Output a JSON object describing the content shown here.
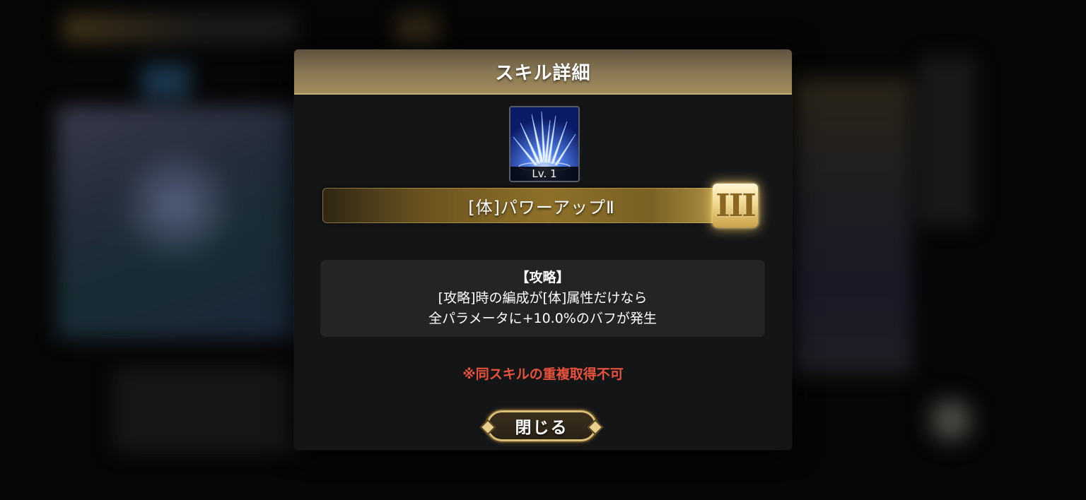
{
  "dialog": {
    "title": "スキル詳細",
    "skill": {
      "icon": "blue-ice-spikes-skill-icon",
      "level": "Lv. 1",
      "name": "[体]パワーアップⅡ",
      "rank": "III"
    },
    "description": {
      "title": "【攻略】",
      "line1": "[攻略]時の編成が[体]属性だけなら",
      "line2": "全パラメータに+10.0%のバフが発生"
    },
    "warning": "※同スキルの重複取得不可",
    "close_label": "閉じる"
  },
  "colors": {
    "header_gold": "#a08a5b",
    "warning_red": "#e8523c",
    "dialog_bg": "#141517",
    "desc_bg": "#232425"
  }
}
